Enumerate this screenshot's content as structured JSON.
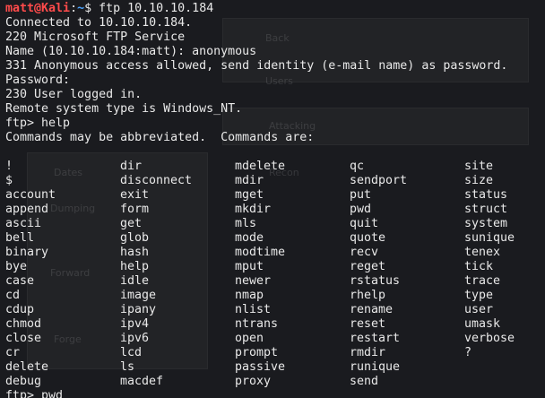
{
  "prompt": {
    "user": "matt@Kali",
    "sep": ":",
    "path": "~",
    "symbol": "$",
    "command": " ftp 10.10.10.184"
  },
  "output_lines": [
    "Connected to 10.10.10.184.",
    "220 Microsoft FTP Service",
    "Name (10.10.10.184:matt): anonymous",
    "331 Anonymous access allowed, send identity (e-mail name) as password.",
    "Password:",
    "230 User logged in.",
    "Remote system type is Windows_NT.",
    "ftp> help",
    "Commands may be abbreviated.  Commands are:"
  ],
  "commands": [
    [
      "!",
      "$",
      "account",
      "append",
      "ascii",
      "bell",
      "binary",
      "bye",
      "case",
      "cd",
      "cdup",
      "chmod",
      "close",
      "cr",
      "delete",
      "debug"
    ],
    [
      "dir",
      "disconnect",
      "exit",
      "form",
      "get",
      "glob",
      "hash",
      "help",
      "idle",
      "image",
      "ipany",
      "ipv4",
      "ipv6",
      "lcd",
      "ls",
      "macdef"
    ],
    [
      "mdelete",
      "mdir",
      "mget",
      "mkdir",
      "mls",
      "mode",
      "modtime",
      "mput",
      "newer",
      "nmap",
      "nlist",
      "ntrans",
      "open",
      "prompt",
      "passive",
      "proxy"
    ],
    [
      "qc",
      "sendport",
      "put",
      "pwd",
      "quit",
      "quote",
      "recv",
      "reget",
      "rstatus",
      "rhelp",
      "rename",
      "reset",
      "restart",
      "rmdir",
      "runique",
      "send"
    ],
    [
      "site",
      "size",
      "status",
      "struct",
      "system",
      "sunique",
      "tenex",
      "tick",
      "trace",
      "type",
      "user",
      "umask",
      "verbose",
      "?"
    ]
  ],
  "last_line": "ftp> pwd",
  "background_ghost": [
    "Back",
    "Users",
    "Attacking",
    "Dates",
    "Dumping",
    "Forward",
    "Forge",
    "Recon"
  ]
}
